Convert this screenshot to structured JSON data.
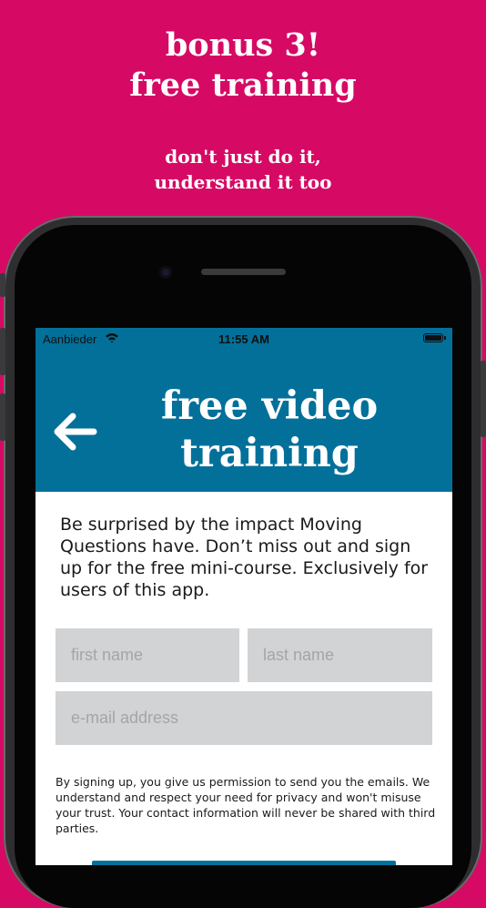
{
  "promo": {
    "title_line1": "bonus 3!",
    "title_line2": "free training",
    "subtitle_line1": "don't just do it,",
    "subtitle_line2": "understand it too"
  },
  "status_bar": {
    "carrier": "Aanbieder",
    "time": "11:55 AM",
    "wifi_icon": "wifi-icon",
    "battery_icon": "battery-icon"
  },
  "header": {
    "back_icon": "arrow-left-icon",
    "title_line1": "free video",
    "title_line2": "training"
  },
  "intro_text": "Be surprised by the impact Moving Questions have. Don’t miss out and sign up for the free mini-course. Exclusively for users of this app.",
  "form": {
    "first_name_placeholder": "first name",
    "last_name_placeholder": "last name",
    "email_placeholder": "e-mail address"
  },
  "consent_text": "By signing up, you give us permission to send you the emails. We understand and respect your need for privacy and won't misuse your trust. Your contact information will never be shared with third parties.",
  "colors": {
    "background_pink": "#d60a64",
    "header_blue": "#03709a",
    "field_gray": "#d2d3d5"
  }
}
